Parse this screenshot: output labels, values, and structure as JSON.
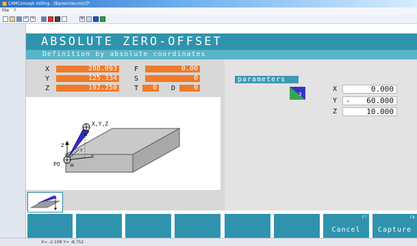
{
  "window": {
    "title": "CAMConcept milling - [Валентин.mcc]*",
    "menu": [
      "File",
      "?"
    ]
  },
  "toolbar": {
    "icons": [
      "new-file-icon",
      "open-file-icon",
      "save-icon",
      "undo-icon",
      "redo-icon",
      "tool-icon",
      "record-icon",
      "stop-icon",
      "window-icon",
      "machine-icon",
      "measure-icon",
      "blue-square-icon",
      "grid-icon"
    ]
  },
  "screen": {
    "title": "ABSOLUTE ZERO-OFFSET",
    "subtitle": "Definition by absolute coordinates"
  },
  "position": {
    "x_label": "X",
    "x_value": "288.093",
    "y_label": "Y",
    "y_value": "125.334",
    "z_label": "Z",
    "z_value": "192.250",
    "f_label": "F",
    "f_value": "0.00",
    "s_label": "S",
    "s_value": "0",
    "t_label": "T",
    "t_value": "0",
    "d_label": "D",
    "d_value": "0"
  },
  "graphic": {
    "label_xyz": "X,Y,Z",
    "label_w_top": "W",
    "label_po": "PO",
    "label_w_bottom": "W",
    "label_z": "Z",
    "label_y": "Y",
    "label_x": "X"
  },
  "parameters": {
    "tab_label": "parameters",
    "icon_badge": "3",
    "x_label": "X",
    "x_sign": "",
    "x_value": "0.000",
    "y_label": "Y",
    "y_sign": "-",
    "y_value": "60.000",
    "z_label": "Z",
    "z_sign": "",
    "z_value": "10.000"
  },
  "softkeys": [
    {
      "fkey": "",
      "label": ""
    },
    {
      "fkey": "",
      "label": ""
    },
    {
      "fkey": "",
      "label": ""
    },
    {
      "fkey": "",
      "label": ""
    },
    {
      "fkey": "",
      "label": ""
    },
    {
      "fkey": "",
      "label": ""
    },
    {
      "fkey": "F7",
      "label": "Cancel"
    },
    {
      "fkey": "F8",
      "label": "Capture"
    }
  ],
  "status": {
    "text": "X= -2.108 Y= -8.752"
  },
  "colors": {
    "header": "#2f93ad",
    "subheader": "#5ab4c8",
    "value_field": "#f07a2a",
    "panel": "#d8d8d8"
  }
}
